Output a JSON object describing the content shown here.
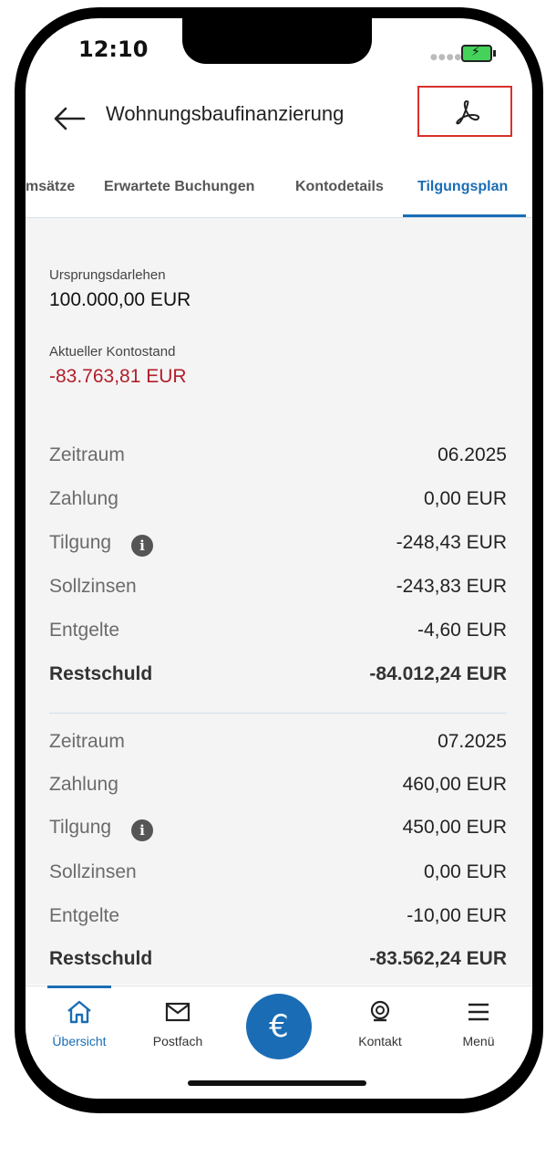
{
  "status": {
    "time": "12:10"
  },
  "header": {
    "title": "Wohnungsbaufinanzierung"
  },
  "tabs": [
    {
      "label": "msätze"
    },
    {
      "label": "Erwartete Buchungen"
    },
    {
      "label": "Kontodetails"
    },
    {
      "label": "Tilgungsplan"
    }
  ],
  "summary": {
    "origin_label": "Ursprungsdarlehen",
    "origin_value": "100.000,00 EUR",
    "balance_label": "Aktueller Kontostand",
    "balance_value": "-83.763,81 EUR"
  },
  "periods": [
    {
      "rows": [
        {
          "label": "Zeitraum",
          "value": "06.2025"
        },
        {
          "label": "Zahlung",
          "value": "0,00 EUR"
        },
        {
          "label": "Tilgung",
          "value": "-248,43 EUR"
        },
        {
          "label": "Sollzinsen",
          "value": "-243,83 EUR"
        },
        {
          "label": "Entgelte",
          "value": "-4,60 EUR"
        },
        {
          "label": "Restschuld",
          "value": "-84.012,24 EUR"
        }
      ]
    },
    {
      "rows": [
        {
          "label": "Zeitraum",
          "value": "07.2025"
        },
        {
          "label": "Zahlung",
          "value": "460,00 EUR"
        },
        {
          "label": "Tilgung",
          "value": "450,00 EUR"
        },
        {
          "label": "Sollzinsen",
          "value": "0,00 EUR"
        },
        {
          "label": "Entgelte",
          "value": "-10,00 EUR"
        },
        {
          "label": "Restschuld",
          "value": "-83.562,24 EUR"
        }
      ]
    }
  ],
  "nav": [
    {
      "label": "Übersicht"
    },
    {
      "label": "Postfach"
    },
    {
      "label": "Kontakt"
    },
    {
      "label": "Menü"
    }
  ],
  "colors": {
    "accent": "#1a6db4",
    "negative": "#b21f2b",
    "highlight_box": "#d9302c"
  },
  "icons": [
    "back-arrow-icon",
    "pdf-icon",
    "info-icon",
    "home-icon",
    "mail-icon",
    "euro-icon",
    "contact-icon",
    "menu-icon"
  ]
}
